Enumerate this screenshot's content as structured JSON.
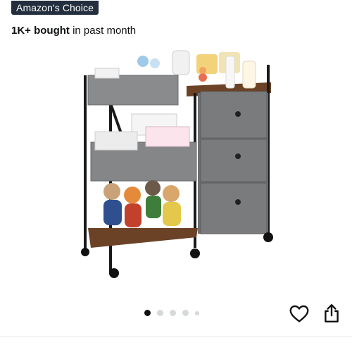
{
  "badge": {
    "label": "Amazon's Choice"
  },
  "social_proof": {
    "count": "1K+ bought",
    "suffix": " in past month"
  },
  "gallery": {
    "total_dots": 5,
    "active_index": 0
  },
  "actions": {
    "heart_icon": "heart-outline-icon",
    "share_icon": "share-icon"
  },
  "colors": {
    "badge_bg": "#232f3e",
    "dot_active": "#111111",
    "dot_inactive": "#d5d9d9"
  }
}
